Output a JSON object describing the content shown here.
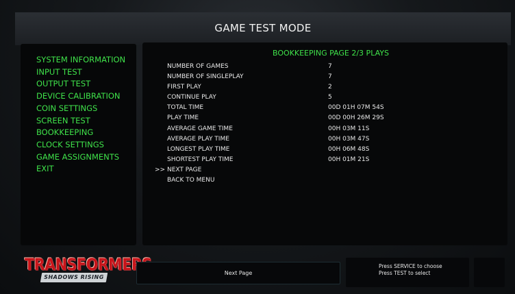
{
  "header": {
    "title": "GAME TEST MODE"
  },
  "menu": {
    "items": [
      "SYSTEM INFORMATION",
      "INPUT TEST",
      "OUTPUT TEST",
      "DEVICE CALIBRATION",
      "COIN SETTINGS",
      "SCREEN TEST",
      "BOOKKEEPING",
      "CLOCK SETTINGS",
      "GAME ASSIGNMENTS",
      "EXIT"
    ]
  },
  "bookkeeping": {
    "heading": "BOOKKEEPING PAGE 2/3 PLAYS",
    "rows": [
      {
        "label": "NUMBER OF GAMES",
        "value": "7"
      },
      {
        "label": "NUMBER OF SINGLEPLAY",
        "value": "7"
      },
      {
        "label": "FIRST PLAY",
        "value": "2"
      },
      {
        "label": "CONTINUE PLAY",
        "value": "5"
      },
      {
        "label": "TOTAL TIME",
        "value": "00D 01H 07M 54S"
      },
      {
        "label": "PLAY TIME",
        "value": "00D 00H 26M 29S"
      },
      {
        "label": "AVERAGE GAME TIME",
        "value": "00H 03M 11S"
      },
      {
        "label": "AVERAGE PLAY TIME",
        "value": "00H 03M 47S"
      },
      {
        "label": "LONGEST PLAY TIME",
        "value": "00H 06M 48S"
      },
      {
        "label": "SHORTEST PLAY TIME",
        "value": "00H 01M 21S"
      }
    ],
    "options": [
      {
        "cursor": ">>",
        "label": "NEXT PAGE"
      },
      {
        "cursor": "",
        "label": "BACK TO MENU"
      }
    ]
  },
  "logo": {
    "main": "TRANSFORMERS",
    "sub": "SHADOWS RISING"
  },
  "footer": {
    "next_label": "Next Page",
    "help_line1": "Press SERVICE to choose",
    "help_line2": "Press TEST to select"
  },
  "colors": {
    "menu_text": "#3fe24a",
    "logo_red": "#c8141a"
  }
}
